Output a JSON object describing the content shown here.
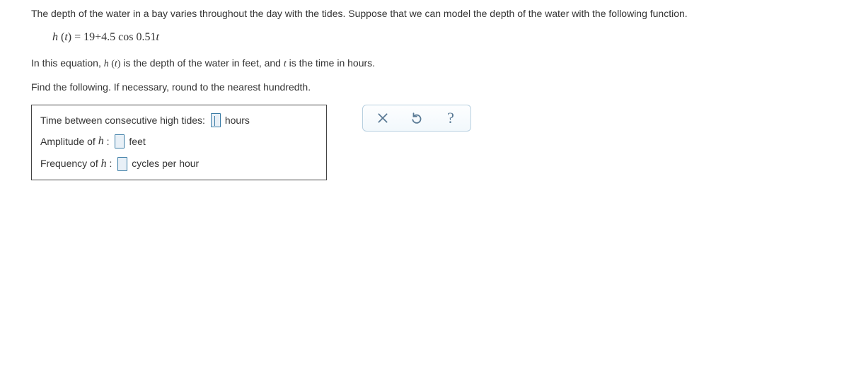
{
  "problem": {
    "intro": "The depth of the water in a bay varies throughout the day with the tides. Suppose that we can model the depth of the water with the following function.",
    "equation": {
      "lhs_func": "h",
      "lhs_var": "t",
      "eq": " = ",
      "constant": "19",
      "plus": "+",
      "amplitude": "4.5",
      "trig": "cos",
      "coef": "0.51",
      "arg": "t"
    },
    "context_pre": "In this equation, ",
    "context_func": "h",
    "context_var": "t",
    "context_mid": " is the depth of the water in feet, and ",
    "context_var2": "t",
    "context_post": " is the time in hours.",
    "instruction": "Find the following. If necessary, round to the nearest hundredth."
  },
  "answers": {
    "period": {
      "label": "Time between consecutive high tides: ",
      "unit": "hours"
    },
    "amplitude": {
      "label_pre": "Amplitude of ",
      "var": "h",
      "label_colon": " : ",
      "unit": "feet"
    },
    "frequency": {
      "label_pre": "Frequency of ",
      "var": "h",
      "label_colon": " : ",
      "unit": "cycles per hour"
    }
  },
  "toolbar": {
    "clear_icon": "close-icon",
    "undo_icon": "undo-icon",
    "help_icon": "help-icon"
  }
}
